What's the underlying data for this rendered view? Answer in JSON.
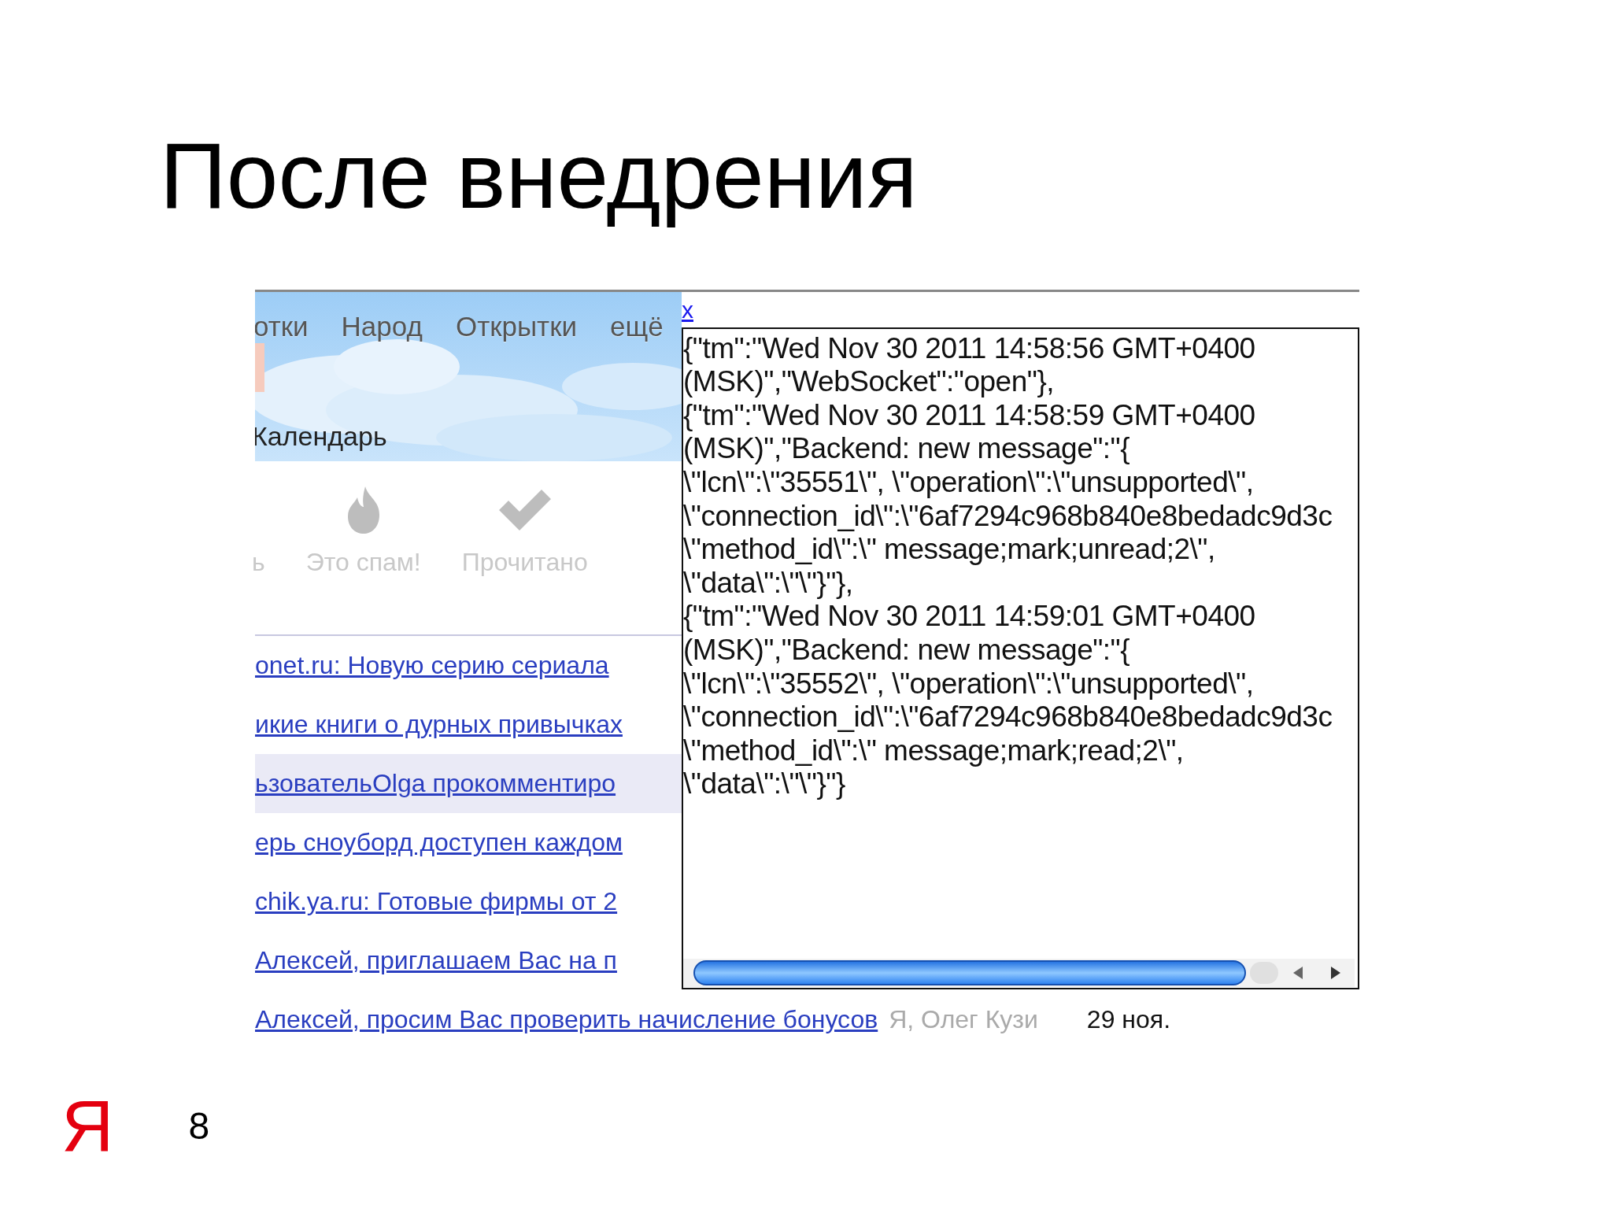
{
  "slide": {
    "title": "После внедрения",
    "logo": "Я",
    "page_number": "8"
  },
  "mail": {
    "nav": [
      "отки",
      "Народ",
      "Открытки",
      "ещё"
    ],
    "calendar_link": "Календарь",
    "toolbar": [
      {
        "kind": "plain",
        "label": "ь",
        "disabled": true
      },
      {
        "kind": "flame",
        "label": "Это спам!",
        "disabled": true
      },
      {
        "kind": "check",
        "label": "Прочитано",
        "disabled": true
      }
    ],
    "messages": [
      {
        "subject": "onet.ru: Новую серию сериала",
        "selected": false
      },
      {
        "subject": "икие книги о дурных привычках",
        "selected": false
      },
      {
        "subject": "ьзовательOlga прокомментиро",
        "selected": true
      },
      {
        "subject": "ерь сноуборд доступен каждом",
        "selected": false
      },
      {
        "subject": "chik.ya.ru: Готовые фирмы от 2",
        "selected": false
      },
      {
        "subject": "Алексей, приглашаем Вас на п",
        "selected": false
      },
      {
        "subject": "Алексей, просим Вас проверить начисление бонусов",
        "sender": "Я, Олег Кузи",
        "date": "29 ноя.",
        "selected": false
      }
    ]
  },
  "log_popup": {
    "close": "x",
    "lines": [
      "{\"tm\":\"Wed Nov 30 2011 14:58:56 GMT+0400",
      "(MSK)\",\"WebSocket\":\"open\"},",
      "{\"tm\":\"Wed Nov 30 2011 14:58:59 GMT+0400",
      "(MSK)\",\"Backend: new message\":\"{",
      "\\\"lcn\\\":\\\"35551\\\", \\\"operation\\\":\\\"unsupported\\\",",
      "\\\"connection_id\\\":\\\"6af7294c968b840e8bedadc9d3c",
      "\\\"method_id\\\":\\\" message;mark;unread;2\\\",",
      "\\\"data\\\":\\\"\\\"}\"},",
      "{\"tm\":\"Wed Nov 30 2011 14:59:01 GMT+0400",
      "(MSK)\",\"Backend: new message\":\"{",
      "\\\"lcn\\\":\\\"35552\\\", \\\"operation\\\":\\\"unsupported\\\",",
      "\\\"connection_id\\\":\\\"6af7294c968b840e8bedadc9d3c",
      "\\\"method_id\\\":\\\" message;mark;read;2\\\",",
      "\\\"data\\\":\\\"\\\"}\"}"
    ]
  }
}
